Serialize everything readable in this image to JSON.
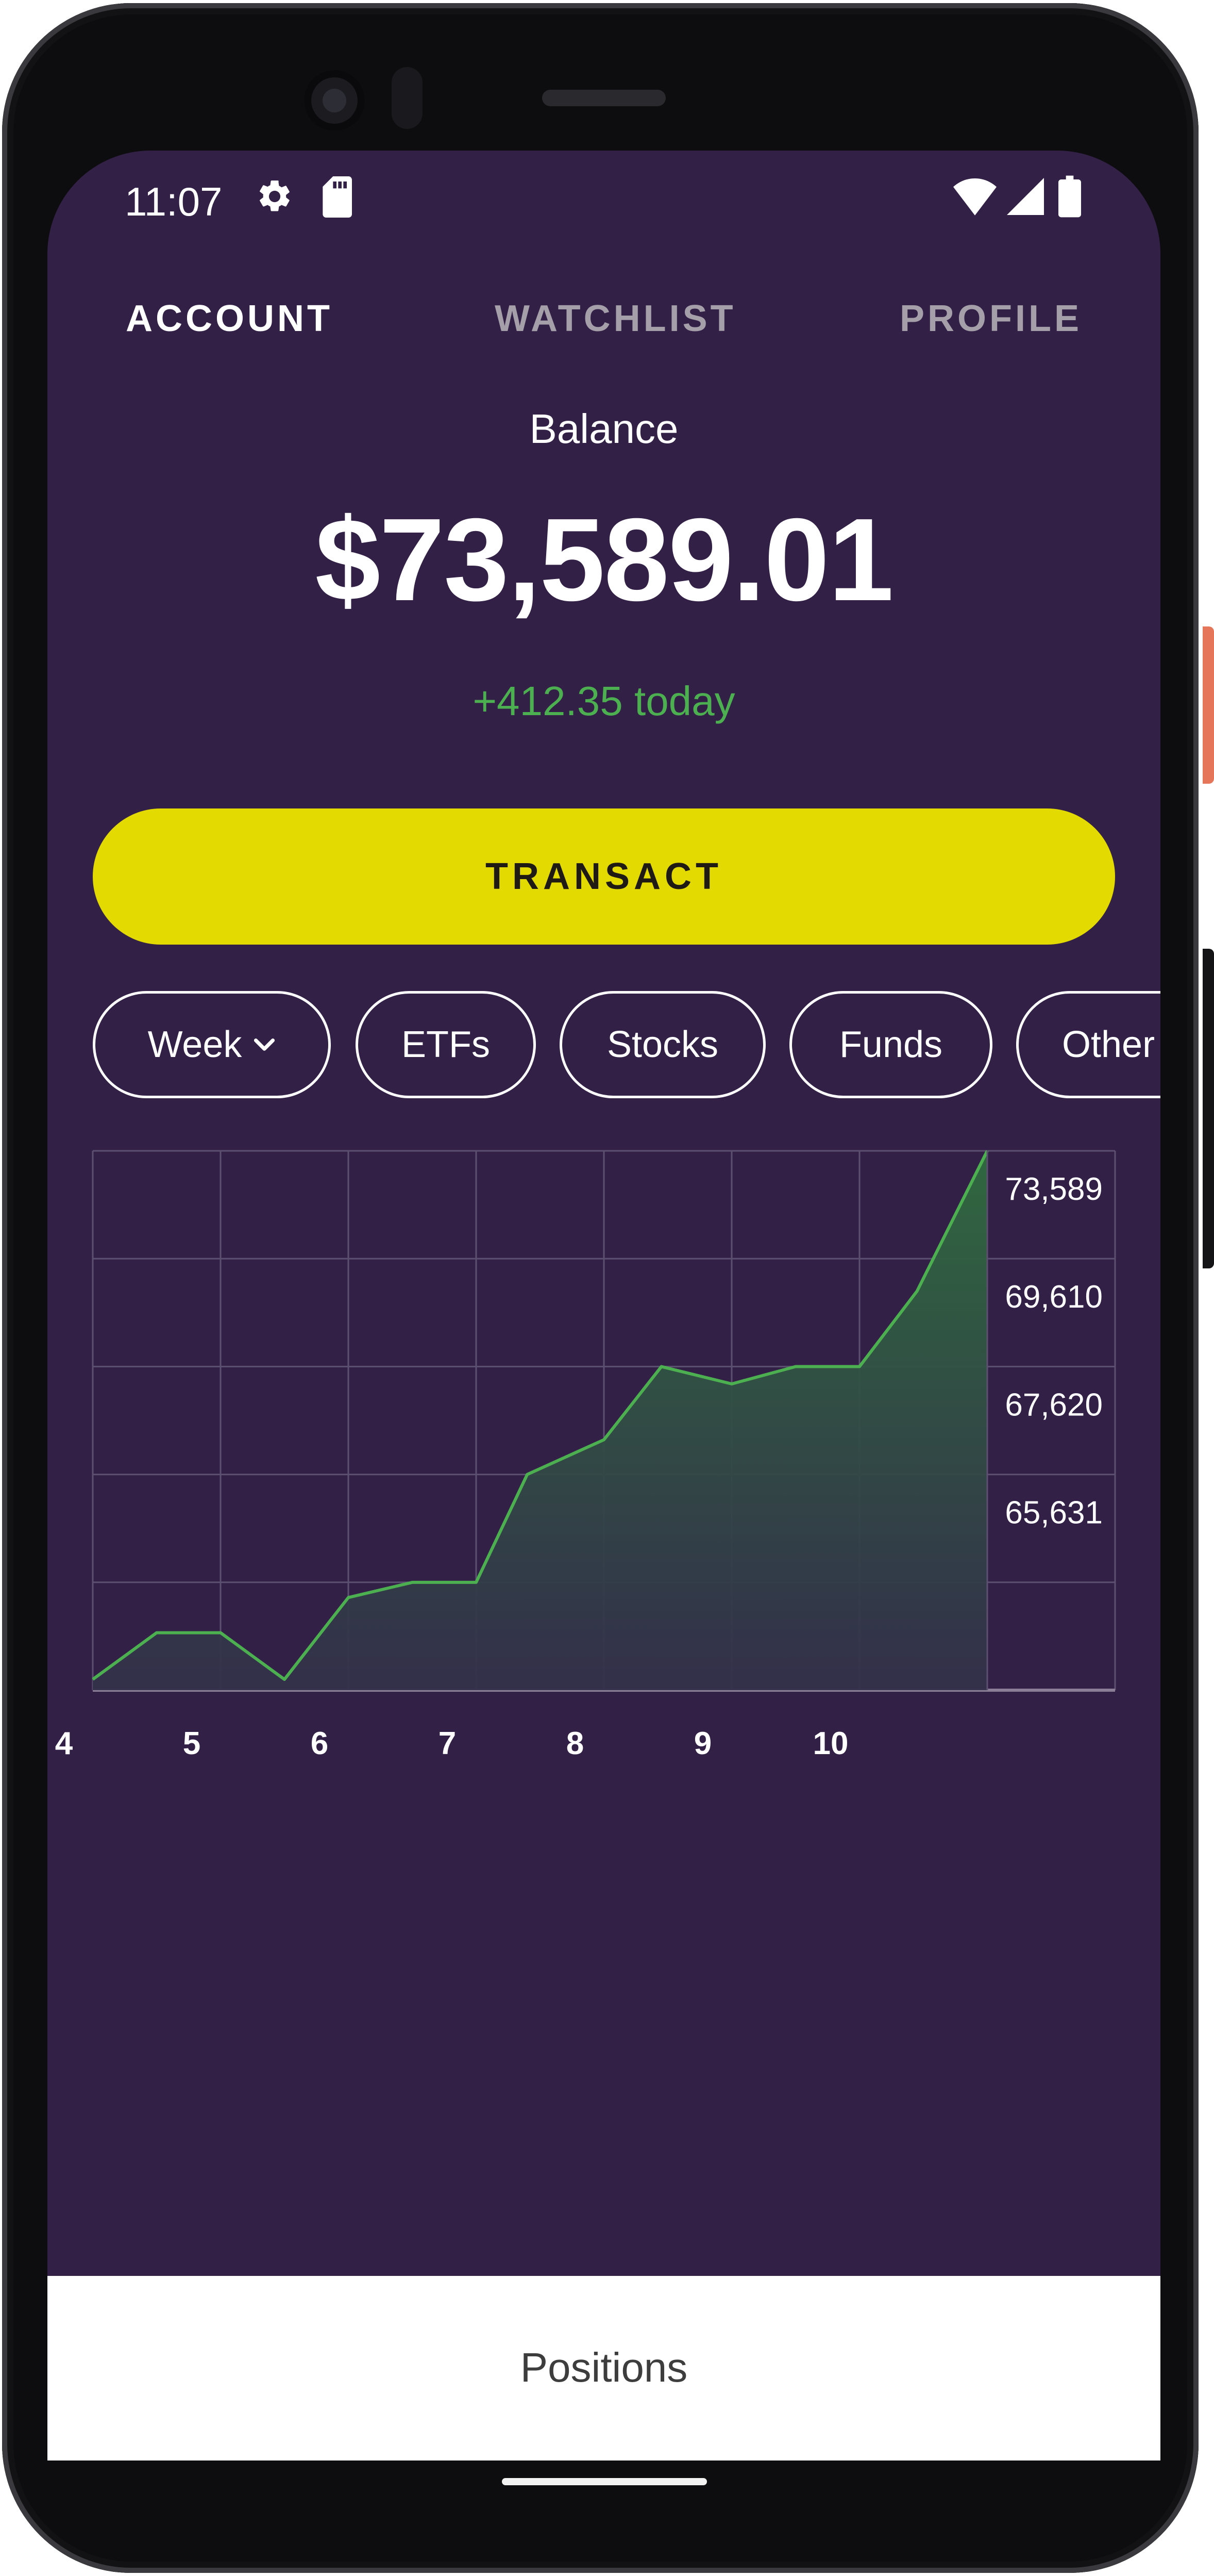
{
  "status_bar": {
    "time": "11:07",
    "icons": [
      "gear-icon",
      "sdcard-icon",
      "wifi-icon",
      "signal-icon",
      "battery-icon"
    ]
  },
  "tabs": [
    {
      "label": "ACCOUNT",
      "active": true
    },
    {
      "label": "WATCHLIST",
      "active": false
    },
    {
      "label": "PROFILE",
      "active": false
    }
  ],
  "balance": {
    "label": "Balance",
    "amount": "$73,589.01",
    "change": "+412.35 today"
  },
  "transact_button": {
    "label": "TRANSACT"
  },
  "filters": {
    "period": {
      "label": "Week",
      "icon": "chevron-down-icon"
    },
    "chips": [
      "ETFs",
      "Stocks",
      "Funds",
      "Other"
    ]
  },
  "chart_data": {
    "type": "area",
    "x_ticks": [
      "4",
      "5",
      "6",
      "7",
      "8",
      "9",
      "10"
    ],
    "y_ticks": [
      "73,589",
      "69,610",
      "67,620",
      "65,631"
    ],
    "x": [
      4.0,
      4.5,
      5.0,
      5.5,
      6.0,
      6.5,
      7.0,
      7.4,
      8.0,
      8.45,
      9.0,
      9.5,
      10.0,
      10.45,
      11.0
    ],
    "y": [
      63840,
      64700,
      64700,
      63840,
      65350,
      65630,
      65630,
      67620,
      68260,
      69610,
      69290,
      69610,
      69610,
      71000,
      73589
    ],
    "x_range": [
      4,
      12
    ],
    "y_range": [
      63641,
      73589
    ],
    "y_gridlines": [
      63641,
      65631,
      67620,
      69610,
      71600,
      73589
    ],
    "grid": true,
    "colors": {
      "line": "#4caf50",
      "fill_top": "#2f6b3f",
      "fill_bottom": "#33304a",
      "grid": "#5c5070",
      "axis": "#8a7f96",
      "tick_label": "#ffffff"
    }
  },
  "bottom_sheet": {
    "label": "Positions"
  },
  "colors": {
    "background": "#332047",
    "accent": "#e2da00",
    "positive": "#4caf50",
    "tab_inactive": "#a59faa"
  }
}
